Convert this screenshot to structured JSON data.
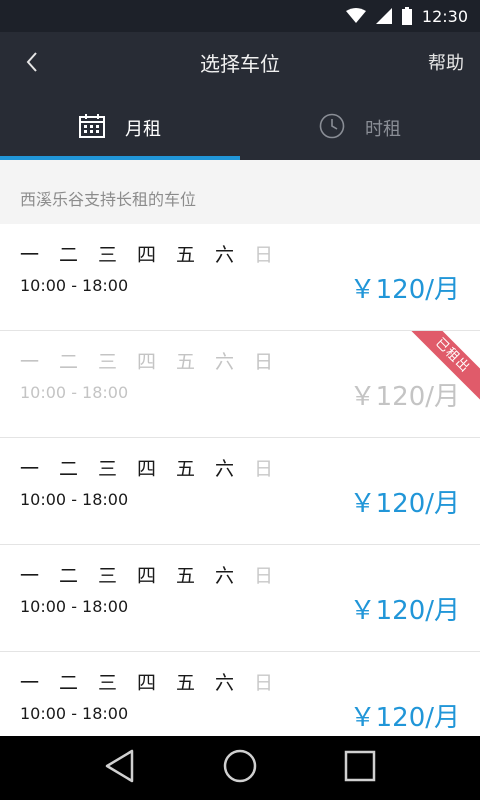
{
  "status": {
    "time": "12:30"
  },
  "header": {
    "title": "选择车位",
    "help_label": "帮助"
  },
  "tabs": [
    {
      "label": "月租",
      "active": true
    },
    {
      "label": "时租",
      "active": false
    }
  ],
  "section_title": "西溪乐谷支持长租的车位",
  "day_labels": [
    "一",
    "二",
    "三",
    "四",
    "五",
    "六",
    "日"
  ],
  "slots": [
    {
      "time_range": "10:00 - 18:00",
      "price": "￥120/月",
      "rented": false
    },
    {
      "time_range": "10:00 - 18:00",
      "price": "￥120/月",
      "rented": true,
      "badge": "已租出"
    },
    {
      "time_range": "10:00 - 18:00",
      "price": "￥120/月",
      "rented": false
    },
    {
      "time_range": "10:00 - 18:00",
      "price": "￥120/月",
      "rented": false
    },
    {
      "time_range": "10:00 - 18:00",
      "price": "￥120/月",
      "rented": false
    }
  ],
  "colors": {
    "accent": "#2196d8",
    "header_bg": "#282c35",
    "badge": "#e05b6a"
  }
}
